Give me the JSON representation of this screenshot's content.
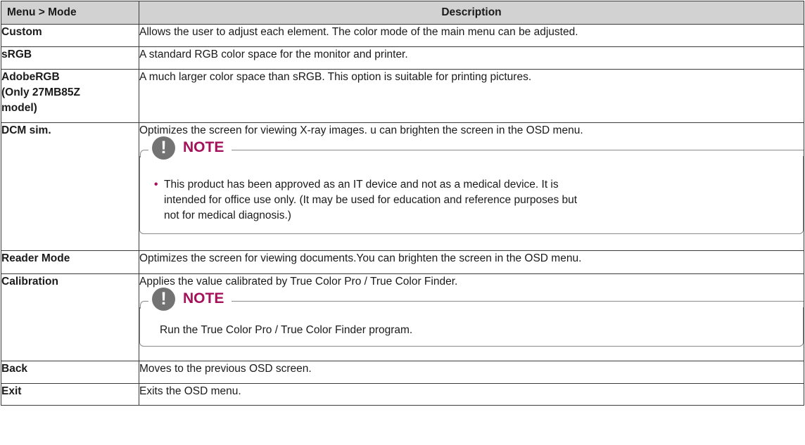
{
  "table": {
    "header_menu": "Menu > Mode",
    "header_description": "Description"
  },
  "rows": {
    "custom": {
      "name": "Custom",
      "description": "Allows the user to adjust each element. The color mode of the main menu can be adjusted."
    },
    "srgb": {
      "name": "sRGB",
      "description": "A standard RGB color space for the monitor and printer."
    },
    "adobergb": {
      "name_line1": "AdobeRGB",
      "name_line2": "(Only 27MB85Z",
      "name_line3": "model)",
      "description": "A much larger color space than sRGB. This option is suitable for printing pictures."
    },
    "dcm": {
      "name": "DCM sim.",
      "description": "Optimizes the screen for viewing X-ray images. u can brighten the screen in the OSD menu.",
      "note_title": "NOTE",
      "note_icon": "!",
      "note_bullet": "•",
      "note_line1": "This product has been approved as an IT device and not as a medical device. It is",
      "note_line2": "intended for office use only. (It may be used for education and reference purposes but",
      "note_line3": "not for medical diagnosis.)"
    },
    "reader": {
      "name": "Reader Mode",
      "description": "Optimizes the screen for viewing documents.You can brighten the screen in the OSD menu."
    },
    "calibration": {
      "name": "Calibration",
      "description": "Applies the value calibrated by True Color Pro / True Color Finder.",
      "note_title": "NOTE",
      "note_icon": "!",
      "note_text": "Run the True Color Pro / True Color Finder program."
    },
    "back": {
      "name": "Back",
      "description": "Moves to the previous OSD screen."
    },
    "exit": {
      "name": "Exit",
      "description": "Exits the OSD menu."
    }
  },
  "colors": {
    "header_bg": "#d2d2d2",
    "note_accent": "#a5125c",
    "note_icon_bg": "#737373",
    "border": "#3a3a3a"
  },
  "icons": {
    "note": "exclamation-circle-icon",
    "bullet": "bullet-dot-icon"
  }
}
